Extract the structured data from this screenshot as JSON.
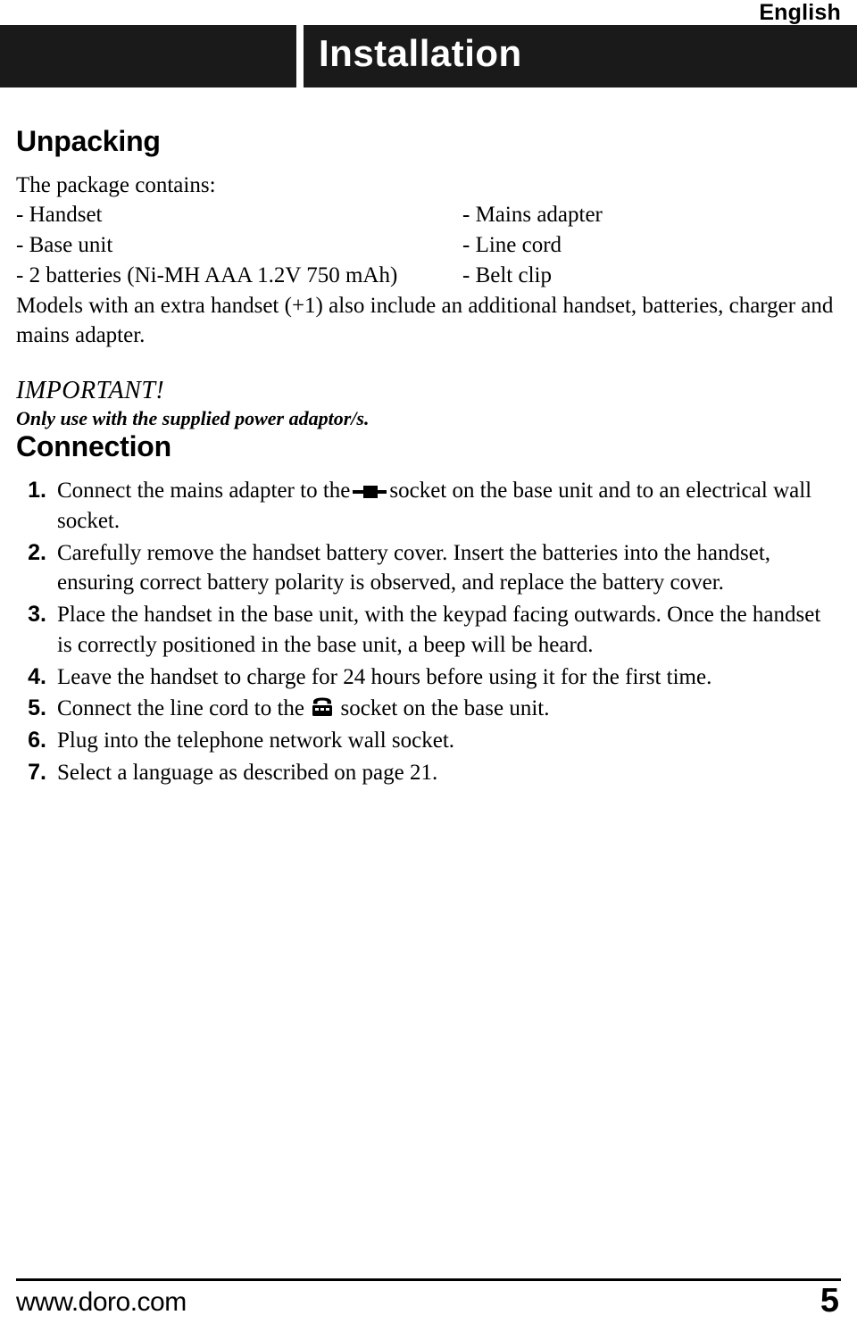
{
  "header": {
    "language": "English",
    "chapter_title": "Installation"
  },
  "unpacking": {
    "heading": "Unpacking",
    "intro": "The package contains:",
    "items_left": [
      "- Handset",
      "- Base unit",
      "- 2 batteries (Ni-MH AAA 1.2V 750 mAh)"
    ],
    "items_right": [
      "- Mains adapter",
      "- Line cord",
      "- Belt clip"
    ],
    "models_note": "Models with an extra handset (+1) also include an additional handset, batteries, charger and mains adapter.",
    "important_title": "IMPORTANT!",
    "important_sub": "Only use with the supplied power adaptor/s."
  },
  "connection": {
    "heading": "Connection",
    "steps": [
      {
        "num": "1.",
        "text_before": "Connect the mains adapter to the",
        "icon": "power-socket-icon",
        "text_after": "socket on the base unit and to an electrical wall socket."
      },
      {
        "num": "2.",
        "text_before": "Carefully remove the handset battery cover. Insert the batteries into the handset, ensuring correct battery polarity is observed, and replace the battery cover.",
        "icon": null,
        "text_after": ""
      },
      {
        "num": "3.",
        "text_before": "Place the handset in the base unit, with the keypad facing outwards. Once the handset is correctly positioned in the base unit, a beep will be heard.",
        "icon": null,
        "text_after": ""
      },
      {
        "num": "4.",
        "text_before": "Leave the handset to charge for 24 hours before using it for the first time.",
        "icon": null,
        "text_after": ""
      },
      {
        "num": "5.",
        "text_before": "Connect the line cord to the",
        "icon": "telephone-icon",
        "text_after": "socket on the base unit."
      },
      {
        "num": "6.",
        "text_before": "Plug into the telephone network wall socket.",
        "icon": null,
        "text_after": ""
      },
      {
        "num": "7.",
        "text_before": "Select a language as described on page 21.",
        "icon": null,
        "text_after": ""
      }
    ]
  },
  "footer": {
    "url": "www.doro.com",
    "page_number": "5"
  },
  "colors": {
    "title_bar": "#1a1a1a",
    "text": "#000000",
    "page_background": "#ffffff"
  }
}
